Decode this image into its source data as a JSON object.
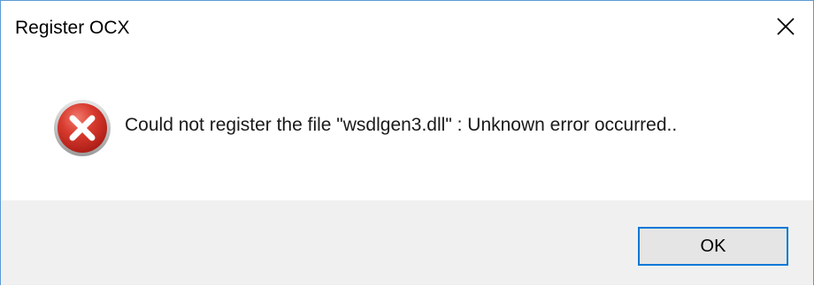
{
  "window": {
    "title": "Register OCX",
    "close_icon": "close-icon"
  },
  "content": {
    "icon": "error-icon",
    "message": "Could not register the file \"wsdlgen3.dll\" : Unknown error occurred.."
  },
  "footer": {
    "ok_label": "OK"
  },
  "colors": {
    "border": "#5a9bd5",
    "footer_bg": "#f0f0f0",
    "button_border": "#0078d7",
    "button_bg": "#e5e5e5",
    "error_red": "#d0302e"
  }
}
